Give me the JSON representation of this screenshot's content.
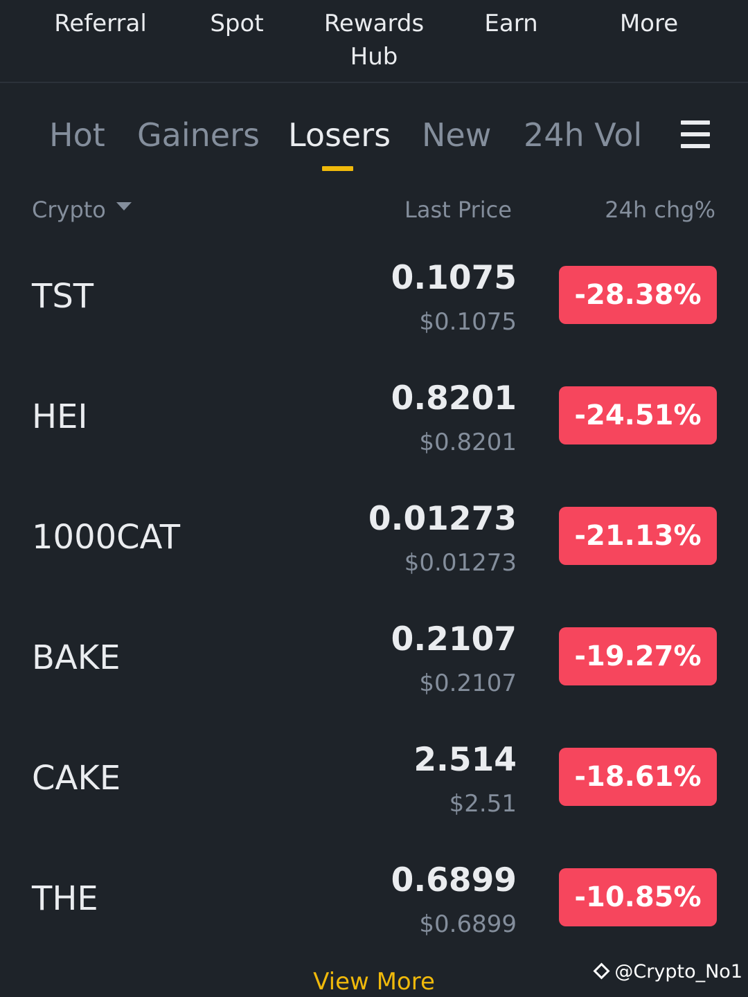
{
  "top_nav": {
    "items": [
      "Referral",
      "Spot",
      "Rewards\nHub",
      "Earn",
      "More"
    ]
  },
  "market_tabs": {
    "items": [
      "Hot",
      "Gainers",
      "Losers",
      "New",
      "24h Vol"
    ],
    "active": "Losers"
  },
  "columns": {
    "crypto": "Crypto",
    "last_price": "Last Price",
    "change": "24h chg%"
  },
  "rows": [
    {
      "symbol": "TST",
      "price": "0.1075",
      "usd": "$0.1075",
      "change": "-28.38%"
    },
    {
      "symbol": "HEI",
      "price": "0.8201",
      "usd": "$0.8201",
      "change": "-24.51%"
    },
    {
      "symbol": "1000CAT",
      "price": "0.01273",
      "usd": "$0.01273",
      "change": "-21.13%"
    },
    {
      "symbol": "BAKE",
      "price": "0.2107",
      "usd": "$0.2107",
      "change": "-19.27%"
    },
    {
      "symbol": "CAKE",
      "price": "2.514",
      "usd": "$2.51",
      "change": "-18.61%"
    },
    {
      "symbol": "THE",
      "price": "0.6899",
      "usd": "$0.6899",
      "change": "-10.85%"
    }
  ],
  "view_more": "View More",
  "watermark": "@Crypto_No1",
  "icons": {
    "menu": "hamburger-menu-icon",
    "sort": "caret-down-icon",
    "watermark": "binance-diamond-icon"
  },
  "colors": {
    "background": "#1e2329",
    "accent": "#f0b90b",
    "down": "#f6465d",
    "muted": "#848e9c",
    "text": "#eaecef"
  }
}
